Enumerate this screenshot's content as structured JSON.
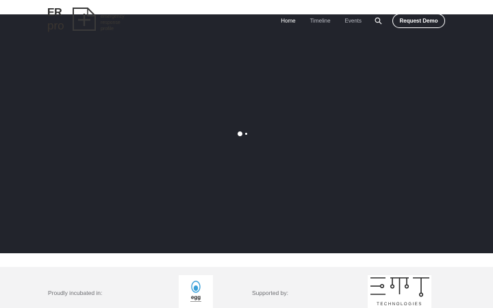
{
  "brand": {
    "logo_top": "ER",
    "logo_bottom": "pro",
    "tagline": [
      "emergency",
      "response",
      "profile"
    ]
  },
  "nav": {
    "items": [
      {
        "label": "Home",
        "active": true
      },
      {
        "label": "Timeline",
        "active": false
      },
      {
        "label": "Events",
        "active": false
      }
    ],
    "search_icon": "magnifier-icon",
    "cta_label": "Request Demo"
  },
  "hero": {
    "background": "#22242c",
    "loader_icon": "loading-dots"
  },
  "footer": {
    "incubated_label": "Proudly incubated in:",
    "incubator_logo": "egg",
    "supported_label": "Supported by:",
    "supporter_logo": "EMT",
    "supporter_subtext": "TECHNOLOGIES"
  },
  "colors": {
    "hero_bg": "#22242c",
    "footer_bg": "#f3f3f4",
    "nav_text": "#b9bbc3",
    "accent_white": "#ffffff"
  }
}
